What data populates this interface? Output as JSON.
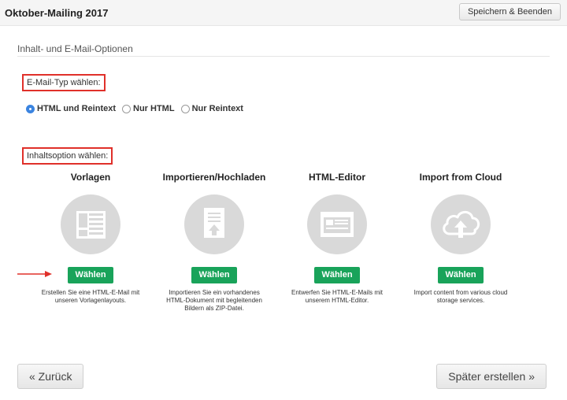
{
  "header": {
    "title": "Oktober-Mailing 2017",
    "save_label": "Speichern & Beenden"
  },
  "section": {
    "title": "Inhalt- und E-Mail-Optionen"
  },
  "email_type": {
    "label": "E-Mail-Typ wählen:",
    "options": [
      {
        "label": "HTML und Reintext",
        "selected": true
      },
      {
        "label": "Nur HTML",
        "selected": false
      },
      {
        "label": "Nur Reintext",
        "selected": false
      }
    ]
  },
  "content_option": {
    "label": "Inhaltsoption wählen:",
    "choose_label": "Wählen",
    "options": [
      {
        "title": "Vorlagen",
        "icon": "template-icon",
        "description": "Erstellen Sie eine HTML-E-Mail mit unseren Vorlagenlayouts."
      },
      {
        "title": "Importieren/Hochladen",
        "icon": "upload-document-icon",
        "description": "Importieren Sie ein vorhandenes HTML-Dokument mit begleitenden Bildern als ZIP-Datei."
      },
      {
        "title": "HTML-Editor",
        "icon": "editor-window-icon",
        "description": "Entwerfen Sie HTML-E-Mails mit unserem HTML-Editor."
      },
      {
        "title": "Import from Cloud",
        "icon": "cloud-upload-icon",
        "description": "Import content from various cloud storage services."
      }
    ]
  },
  "footer": {
    "back_label": "« Zurück",
    "later_label": "Später erstellen »"
  },
  "colors": {
    "accent_green": "#19a35a",
    "highlight_red": "#e0302a",
    "radio_blue": "#3b84e0"
  }
}
